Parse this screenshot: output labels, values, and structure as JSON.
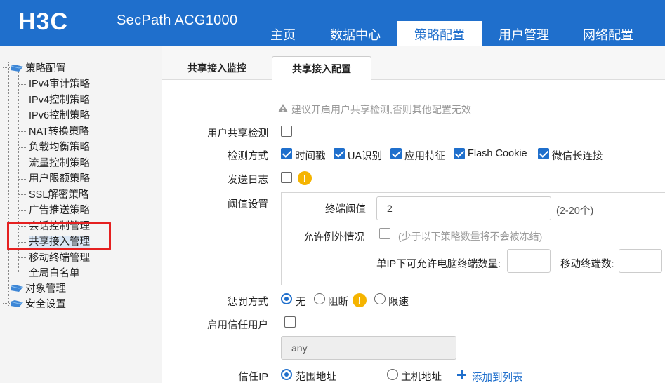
{
  "header": {
    "product": "SecPath ACG1000",
    "nav": [
      "主页",
      "数据中心",
      "策略配置",
      "用户管理",
      "网络配置"
    ],
    "active_nav": "策略配置",
    "bg_color": "#1f6fcc"
  },
  "sidebar": {
    "root_label": "策略配置",
    "items": [
      "IPv4审计策略",
      "IPv4控制策略",
      "IPv6控制策略",
      "NAT转换策略",
      "负载均衡策略",
      "流量控制策略",
      "用户限额策略",
      "SSL解密策略",
      "广告推送策略",
      "会话控制管理",
      "共享接入管理",
      "移动终端管理",
      "全局白名单"
    ],
    "selected": "共享接入管理",
    "other_roots": [
      "对象管理",
      "安全设置"
    ]
  },
  "tabs": [
    "共享接入监控",
    "共享接入配置"
  ],
  "active_tab": "共享接入配置",
  "form": {
    "notice": "建议开启用户共享检测,否则其他配置无效",
    "user_share_detect_label": "用户共享检测",
    "detect_method_label": "检测方式",
    "detect_methods": [
      "时间戳",
      "UA识别",
      "应用特征",
      "Flash Cookie",
      "微信长连接"
    ],
    "send_log_label": "发送日志",
    "threshold_label": "阈值设置",
    "terminal_threshold_label": "终端阈值",
    "terminal_threshold_value": "2",
    "terminal_threshold_hint": "(2-20个)",
    "allow_exception_label": "允许例外情况",
    "allow_exception_hint": "(少于以下策略数量将不会被冻结)",
    "pc_count_label": "单IP下可允许电脑终端数量:",
    "mobile_count_label": "移动终端数:",
    "penalty_label": "惩罚方式",
    "penalty_options": [
      "无",
      "阻断",
      "限速"
    ],
    "penalty_selected": "无",
    "trust_user_label": "启用信任用户",
    "trust_user_value": "any",
    "trust_ip_label": "信任IP",
    "trust_ip_options": [
      "范围地址",
      "主机地址"
    ],
    "trust_ip_selected": "范围地址",
    "add_to_list": "添加到列表"
  }
}
